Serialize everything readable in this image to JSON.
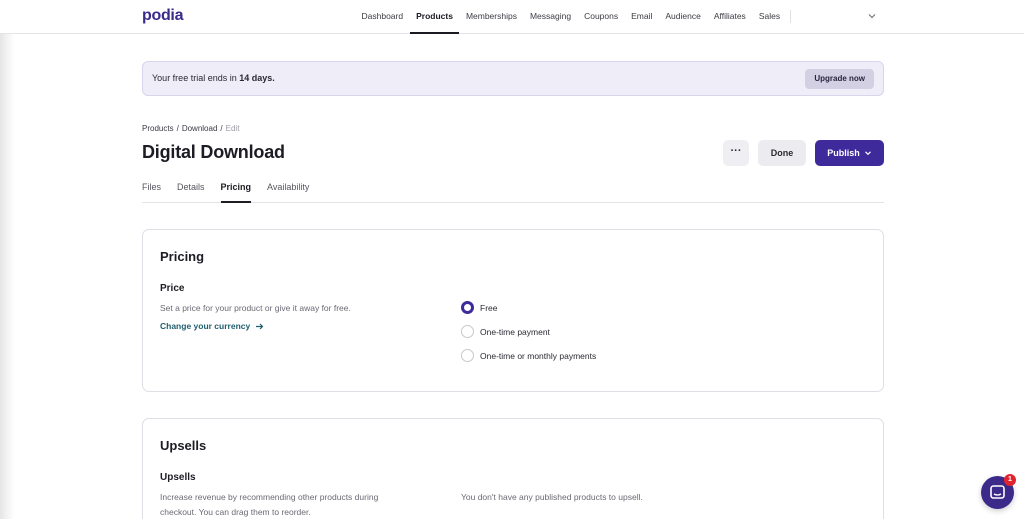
{
  "brand": {
    "logo": "podia",
    "accent": "#3e2a9a"
  },
  "nav": {
    "items": [
      {
        "label": "Dashboard",
        "active": false
      },
      {
        "label": "Products",
        "active": true
      },
      {
        "label": "Memberships",
        "active": false
      },
      {
        "label": "Messaging",
        "active": false
      },
      {
        "label": "Coupons",
        "active": false
      },
      {
        "label": "Email",
        "active": false
      },
      {
        "label": "Audience",
        "active": false
      },
      {
        "label": "Affiliates",
        "active": false
      },
      {
        "label": "Sales",
        "active": false
      }
    ],
    "menu_icon": "chevron-down-icon"
  },
  "trial": {
    "text_prefix": "Your free trial ends in ",
    "days": "14 days.",
    "upgrade_label": "Upgrade now"
  },
  "breadcrumb": {
    "items": [
      "Products",
      "Download",
      "Edit"
    ],
    "separator": "/"
  },
  "page": {
    "title": "Digital Download",
    "more_label": "···",
    "done_label": "Done",
    "publish_label": "Publish"
  },
  "tabs": [
    {
      "label": "Files",
      "active": false
    },
    {
      "label": "Details",
      "active": false
    },
    {
      "label": "Pricing",
      "active": true
    },
    {
      "label": "Availability",
      "active": false
    }
  ],
  "pricing": {
    "card_title": "Pricing",
    "section_title": "Price",
    "description": "Set a price for your product or give it away for free.",
    "currency_link": "Change your currency",
    "options": [
      {
        "label": "Free",
        "checked": true
      },
      {
        "label": "One-time payment",
        "checked": false
      },
      {
        "label": "One-time or monthly payments",
        "checked": false
      }
    ]
  },
  "upsells": {
    "card_title": "Upsells",
    "section_title": "Upsells",
    "description": "Increase revenue by recommending other products during checkout. You can drag them to reorder.",
    "empty_note": "You don't have any published products to upsell."
  },
  "chat": {
    "badge": "1"
  }
}
